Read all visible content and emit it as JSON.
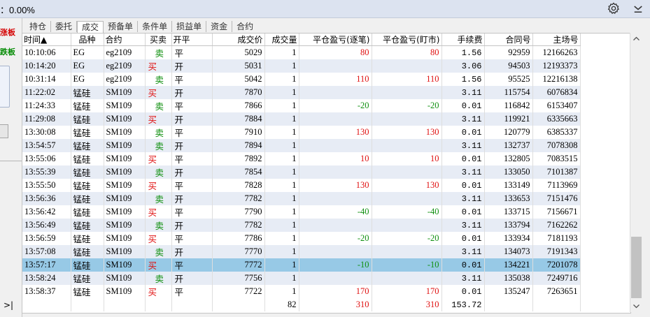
{
  "header": {
    "rate_text": "：0.00%"
  },
  "left_panel": {
    "red_label": "涨板",
    "green_label": "跌板",
    "end_label": ">|"
  },
  "tabs": [
    "持仓",
    "委托",
    "成交",
    "预备单",
    "条件单",
    "损益单",
    "资金",
    "合约"
  ],
  "active_tab": 2,
  "table": {
    "columns": [
      "时间▲",
      "品种",
      "合约",
      "买卖",
      "开平",
      "成交价",
      "成交量",
      "平仓盈亏(逐笔)",
      "平仓盈亏(盯市)",
      "手续费",
      "合同号",
      "主场号"
    ],
    "rows": [
      [
        "10:10:06",
        "EG",
        "eg2109",
        "卖",
        "平",
        "5029",
        "1",
        "80",
        "80",
        "1.56",
        "92959",
        "12166263"
      ],
      [
        "10:14:20",
        "EG",
        "eg2109",
        "买",
        "开",
        "5031",
        "1",
        "",
        "",
        "3.06",
        "94503",
        "12193373"
      ],
      [
        "10:31:14",
        "EG",
        "eg2109",
        "卖",
        "平",
        "5042",
        "1",
        "110",
        "110",
        "1.56",
        "95525",
        "12216138"
      ],
      [
        "11:22:02",
        "锰硅",
        "SM109",
        "买",
        "开",
        "7870",
        "1",
        "",
        "",
        "3.11",
        "115754",
        "6076834"
      ],
      [
        "11:24:33",
        "锰硅",
        "SM109",
        "卖",
        "平",
        "7866",
        "1",
        "-20",
        "-20",
        "0.01",
        "116842",
        "6153407"
      ],
      [
        "11:29:08",
        "锰硅",
        "SM109",
        "买",
        "开",
        "7884",
        "1",
        "",
        "",
        "3.11",
        "119921",
        "6335663"
      ],
      [
        "13:30:08",
        "锰硅",
        "SM109",
        "卖",
        "平",
        "7910",
        "1",
        "130",
        "130",
        "0.01",
        "120779",
        "6385337"
      ],
      [
        "13:54:57",
        "锰硅",
        "SM109",
        "卖",
        "开",
        "7894",
        "1",
        "",
        "",
        "3.11",
        "132737",
        "7078308"
      ],
      [
        "13:55:06",
        "锰硅",
        "SM109",
        "买",
        "平",
        "7892",
        "1",
        "10",
        "10",
        "0.01",
        "132805",
        "7083515"
      ],
      [
        "13:55:39",
        "锰硅",
        "SM109",
        "卖",
        "开",
        "7854",
        "1",
        "",
        "",
        "3.11",
        "133050",
        "7101387"
      ],
      [
        "13:55:50",
        "锰硅",
        "SM109",
        "买",
        "平",
        "7828",
        "1",
        "130",
        "130",
        "0.01",
        "133149",
        "7113969"
      ],
      [
        "13:56:36",
        "锰硅",
        "SM109",
        "卖",
        "开",
        "7782",
        "1",
        "",
        "",
        "3.11",
        "133653",
        "7151476"
      ],
      [
        "13:56:42",
        "锰硅",
        "SM109",
        "买",
        "平",
        "7790",
        "1",
        "-40",
        "-40",
        "0.01",
        "133715",
        "7156671"
      ],
      [
        "13:56:49",
        "锰硅",
        "SM109",
        "卖",
        "开",
        "7782",
        "1",
        "",
        "",
        "3.11",
        "133794",
        "7162262"
      ],
      [
        "13:56:59",
        "锰硅",
        "SM109",
        "买",
        "平",
        "7786",
        "1",
        "-20",
        "-20",
        "0.01",
        "133934",
        "7181193"
      ],
      [
        "13:57:08",
        "锰硅",
        "SM109",
        "卖",
        "开",
        "7770",
        "1",
        "",
        "",
        "3.11",
        "134073",
        "7191343"
      ],
      [
        "13:57:17",
        "锰硅",
        "SM109",
        "买",
        "平",
        "7772",
        "1",
        "-10",
        "-10",
        "0.01",
        "134221",
        "7201078"
      ],
      [
        "13:58:24",
        "锰硅",
        "SM109",
        "卖",
        "开",
        "7756",
        "1",
        "",
        "",
        "3.11",
        "135038",
        "7249716"
      ],
      [
        "13:58:37",
        "锰硅",
        "SM109",
        "买",
        "平",
        "7722",
        "1",
        "170",
        "170",
        "0.01",
        "135247",
        "7263651"
      ]
    ],
    "selected_row": 16,
    "totals": {
      "volume": "82",
      "pnl_each": "310",
      "pnl_mark": "310",
      "fee": "153.72"
    }
  },
  "colors": {
    "buy": "#e01010",
    "sell": "#109010",
    "selected": "#97c9e6",
    "alt_row": "#e7ecf5"
  },
  "icons": {
    "settings": "gear-icon",
    "collapse": "chevron-down-icon",
    "scroll_up": "chevron-up-icon",
    "scroll_down": "chevron-down-icon"
  }
}
